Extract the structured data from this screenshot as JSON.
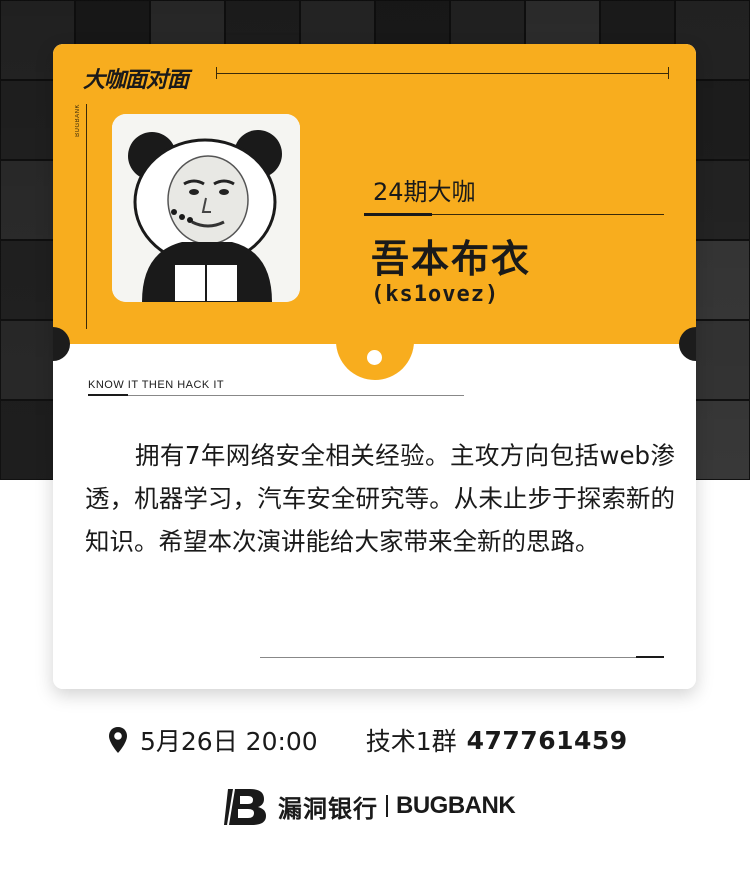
{
  "header": {
    "title": "大咖面对面",
    "vertical_brand": "BUGBANK"
  },
  "speaker": {
    "episode": "24期大咖",
    "name": "吾本布衣",
    "handle": "(ks1ovez)"
  },
  "slogan": "KNOW  IT THEN  HACK  IT",
  "bio": "拥有7年网络安全相关经验。主攻方向包括web渗透，机器学习，汽车安全研究等。从未止步于探索新的知识。希望本次演讲能给大家带来全新的思路。",
  "event": {
    "location_icon": "map-pin-icon",
    "datetime": "5月26日 20:00",
    "group_label": "技术1群",
    "group_number": "477761459"
  },
  "footer": {
    "logo_icon": "bugbank-b-logo",
    "name_cn": "漏洞银行",
    "name_en": "BUGBANK"
  },
  "colors": {
    "accent": "#f8ad1e",
    "text": "#1a1a1a",
    "background_dark": "#1a1a1a"
  }
}
